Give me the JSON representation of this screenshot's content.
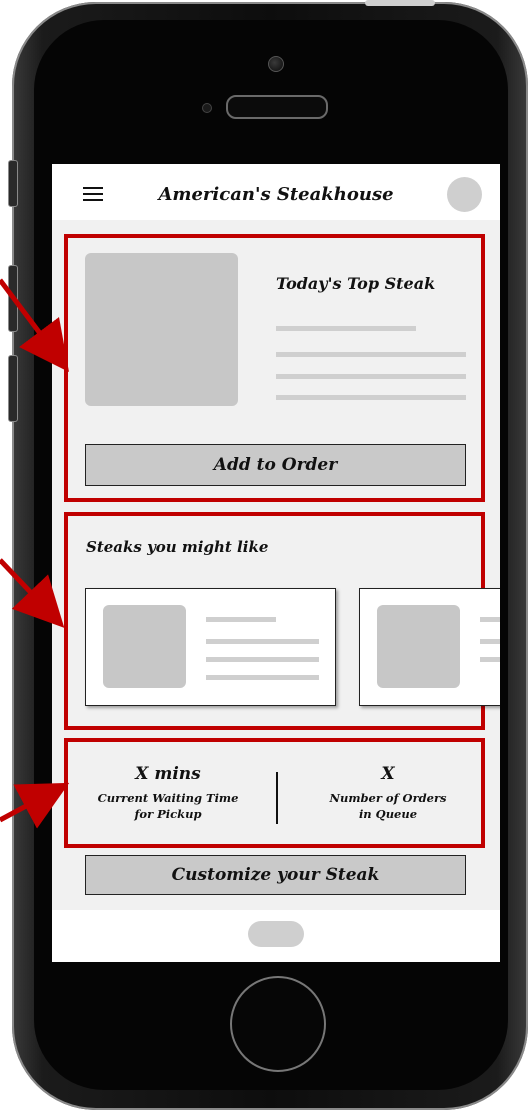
{
  "header": {
    "title": "American's Steakhouse",
    "menu_icon": "hamburger-menu-icon",
    "avatar_icon": "user-avatar-icon"
  },
  "featured": {
    "title": "Today's Top Steak",
    "add_button_label": "Add to Order"
  },
  "recommendations": {
    "title": "Steaks you might like"
  },
  "stats": {
    "wait_value": "X mins",
    "wait_label_line1": "Current Waiting Time",
    "wait_label_line2": "for Pickup",
    "queue_value": "X",
    "queue_label_line1": "Number of Orders",
    "queue_label_line2": "in Queue"
  },
  "customize_button_label": "Customize your Steak",
  "colors": {
    "highlight": "#c00000",
    "placeholder": "#c7c7c7",
    "button": "#c9c9c9",
    "content_bg": "#f1f1f1"
  }
}
